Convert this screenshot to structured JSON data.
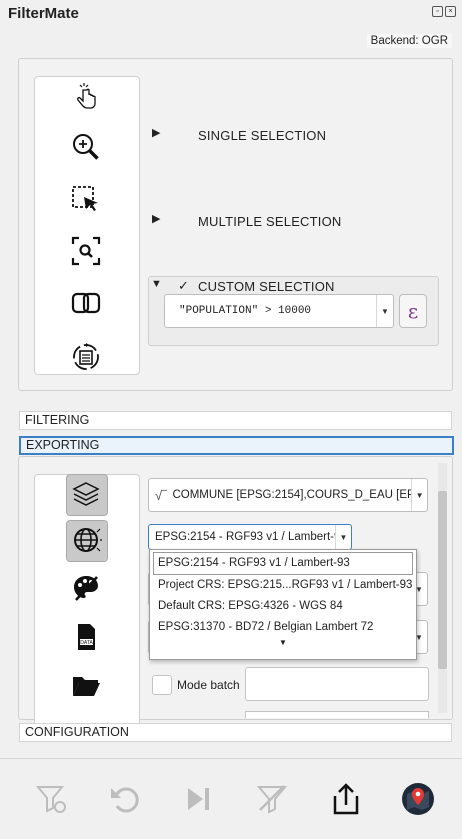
{
  "app": {
    "title": "FilterMate",
    "backend": "Backend: OGR"
  },
  "selection": {
    "single": "SINGLE SELECTION",
    "multiple": "MULTIPLE SELECTION",
    "custom": "CUSTOM SELECTION",
    "custom_check": "✓",
    "expression": "\"POPULATION\" > 10000",
    "expr_button": "ε"
  },
  "sections": {
    "filtering": "FILTERING",
    "exporting": "EXPORTING",
    "configuration": "CONFIGURATION"
  },
  "export": {
    "layers_value": "COMMUNE [EPSG:2154],COURS_D_EAU [EPSG",
    "crs_value": "EPSG:2154 - RGF93 v1 / Lambert-93",
    "crs_options": [
      "EPSG:2154 - RGF93 v1 / Lambert-93",
      "Project CRS: EPSG:215...RGF93 v1 / Lambert-93",
      "Default CRS: EPSG:4326 - WGS 84",
      "EPSG:31370 - BD72 / Belgian Lambert 72"
    ],
    "mode_batch": "Mode batch",
    "data_icon_text": "DATA"
  },
  "colors": {
    "accent": "#3d7fc7",
    "expr_purple": "#7a3a8c",
    "marker_red": "#e53935"
  }
}
